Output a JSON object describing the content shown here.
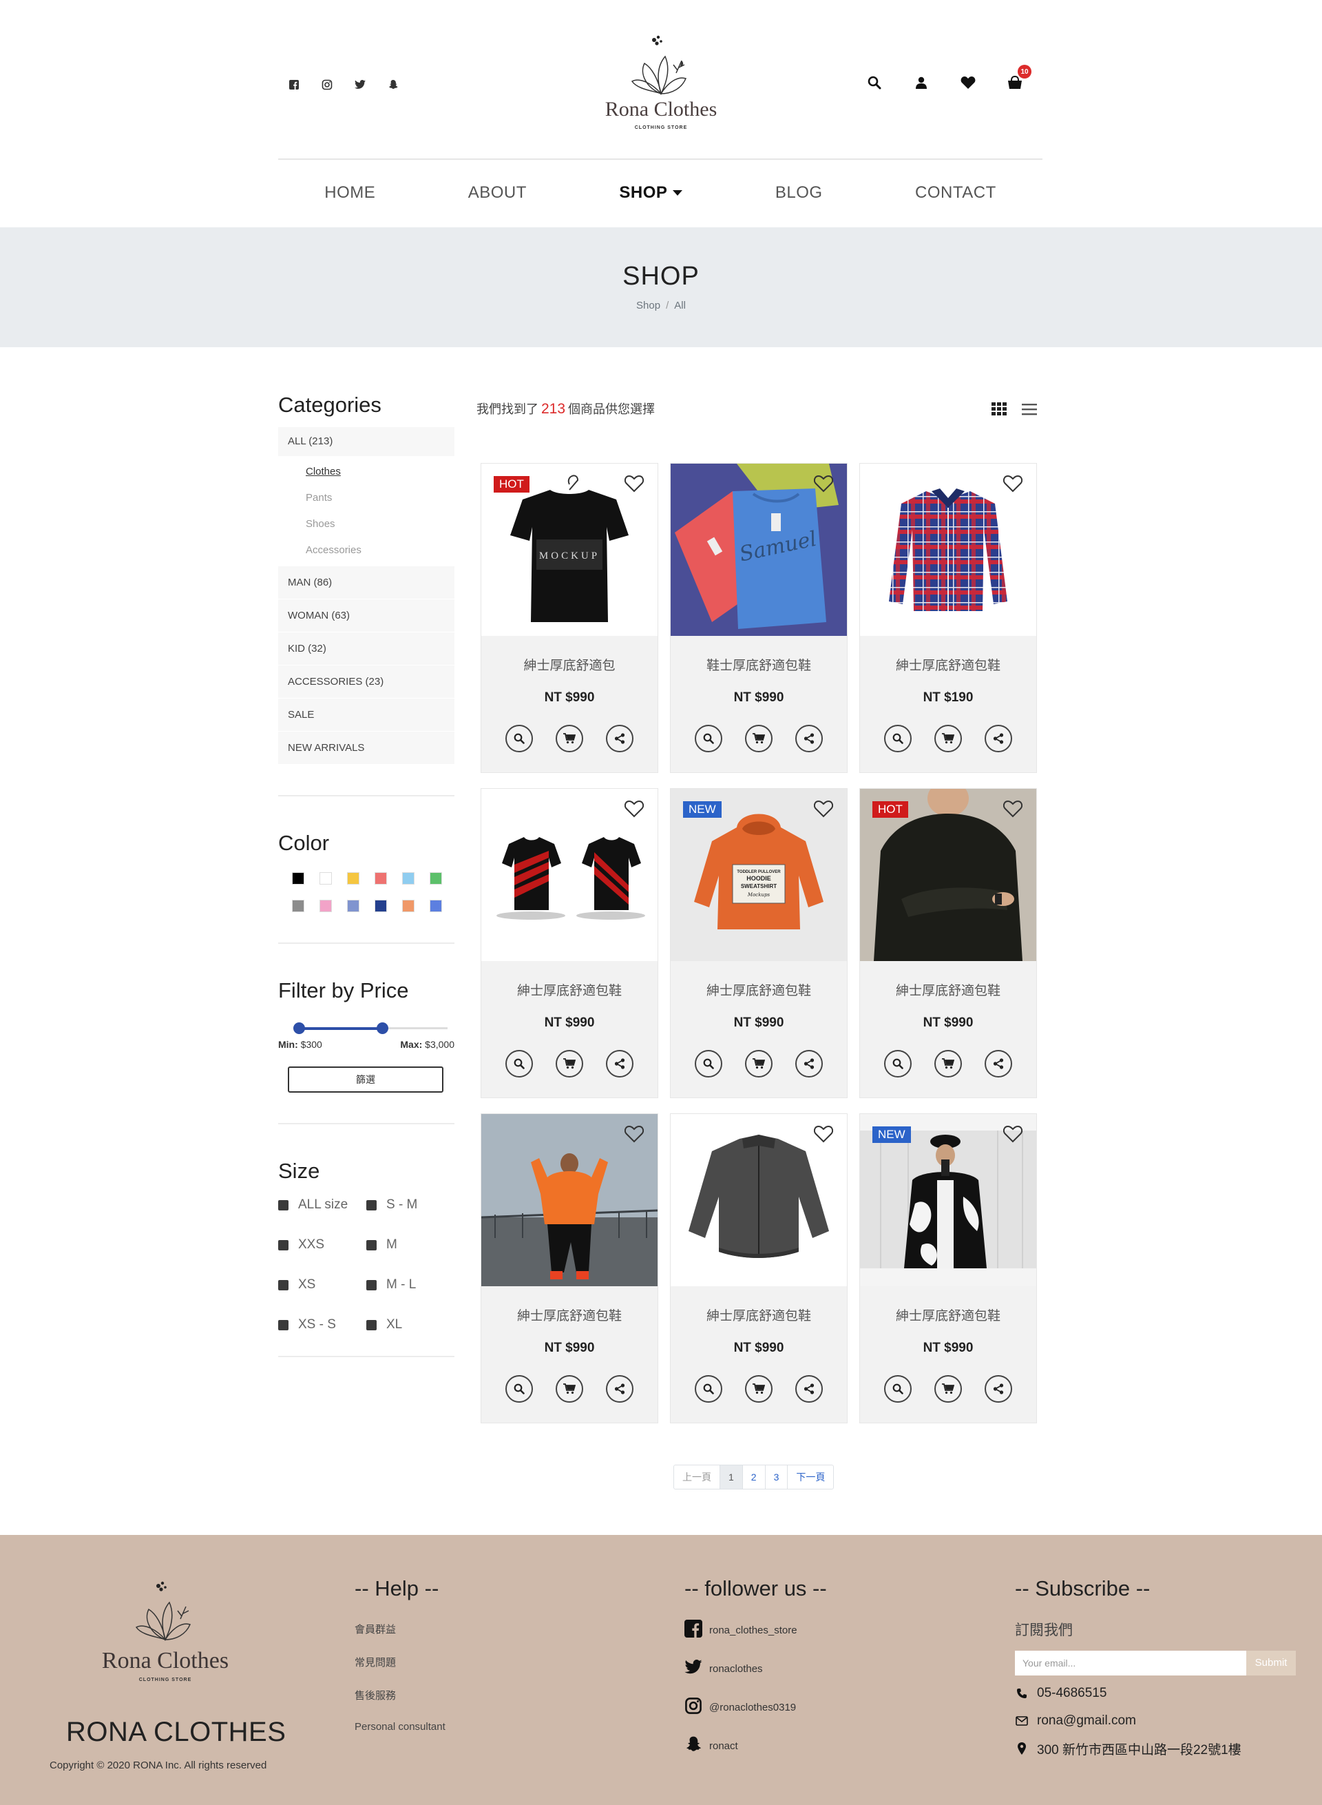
{
  "header": {
    "brand": "Rona Clothes",
    "brand_sub": "CLOTHING STORE",
    "social": [
      "facebook-icon",
      "instagram-icon",
      "twitter-icon",
      "snapchat-icon"
    ],
    "cart_count": "10"
  },
  "nav": {
    "items": [
      {
        "label": "HOME"
      },
      {
        "label": "ABOUT"
      },
      {
        "label": "SHOP"
      },
      {
        "label": "BLOG"
      },
      {
        "label": "CONTACT"
      }
    ]
  },
  "banner": {
    "title": "SHOP",
    "crumb_1": "Shop",
    "crumb_sep": "/",
    "crumb_2": "All"
  },
  "sidebar": {
    "categories_title": "Categories",
    "all": "ALL (213)",
    "sub": [
      "Clothes",
      "Pants",
      "Shoes",
      "Accessories"
    ],
    "cats": [
      "MAN (86)",
      "WOMAN (63)",
      "KID (32)",
      "ACCESSORIES (23)",
      "SALE",
      "NEW ARRIVALS"
    ],
    "color_title": "Color",
    "colors": [
      "#000000",
      "#ffffff",
      "#f5c640",
      "#ee7270",
      "#8fcdf0",
      "#5cc06a",
      "#8c8c8c",
      "#f2a3c8",
      "#8094cf",
      "#24408e",
      "#f09868",
      "#5c7fe0"
    ],
    "price_title": "Filter by Price",
    "min_label": "Min:",
    "min_value": "$300",
    "max_label": "Max:",
    "max_value": "$3,000",
    "filter_button": "篩選",
    "size_title": "Size",
    "sizes": [
      "ALL size",
      "S - M",
      "XXS",
      "M",
      "XS",
      "M - L",
      "XS - S",
      "XL"
    ]
  },
  "results": {
    "prefix": "我們找到了",
    "count": "213",
    "suffix": "個商品供您選擇"
  },
  "products": [
    {
      "name": "紳士厚底舒適包",
      "price": "NT $990",
      "badge": "HOT"
    },
    {
      "name": "鞋士厚底舒適包鞋",
      "price": "NT $990",
      "badge": ""
    },
    {
      "name": "紳士厚底舒適包鞋",
      "price": "NT $190",
      "badge": ""
    },
    {
      "name": "紳士厚底舒適包鞋",
      "price": "NT $990",
      "badge": ""
    },
    {
      "name": "紳士厚底舒適包鞋",
      "price": "NT $990",
      "badge": "NEW"
    },
    {
      "name": "紳士厚底舒適包鞋",
      "price": "NT $990",
      "badge": "HOT"
    },
    {
      "name": "紳士厚底舒適包鞋",
      "price": "NT $990",
      "badge": ""
    },
    {
      "name": "紳士厚底舒適包鞋",
      "price": "NT $990",
      "badge": ""
    },
    {
      "name": "紳士厚底舒適包鞋",
      "price": "NT $990",
      "badge": "NEW"
    }
  ],
  "product_images": {
    "p1_text": "MOCKUP",
    "p2_text": "Samuel",
    "p5_line1": "TODDLER PULLOVER",
    "p5_line2": "HOODIE",
    "p5_line3": "SWEATSHIRT",
    "p5_line4": "Mockups"
  },
  "pagination": {
    "prev": "上一頁",
    "pages": [
      "1",
      "2",
      "3"
    ],
    "next": "下一頁"
  },
  "footer": {
    "brand": "Rona Clothes",
    "brand_sub": "CLOTHING STORE",
    "name": "RONA CLOTHES",
    "copyright": "Copyright © 2020 RONA Inc. All rights reserved",
    "help_title": "-- Help --",
    "help_links": [
      "會員群益",
      "常見問題",
      "售後服務",
      "Personal consultant"
    ],
    "follow_title": "-- follower us --",
    "follow": [
      "rona_clothes_store",
      "ronaclothes",
      "@ronaclothes0319",
      "ronact"
    ],
    "subscribe_title": "-- Subscribe --",
    "subscribe_text": "訂閱我們",
    "email_placeholder": "Your email...",
    "submit": "Submit",
    "phone": "05-4686515",
    "email": "rona@gmail.com",
    "address": "300 新竹市西區中山路一段22號1樓"
  },
  "accent_colors": {
    "hot": "#d01b1b",
    "new": "#2b63c9",
    "footer_bg": "#cfbaab",
    "banner_bg": "#e9ecef"
  }
}
